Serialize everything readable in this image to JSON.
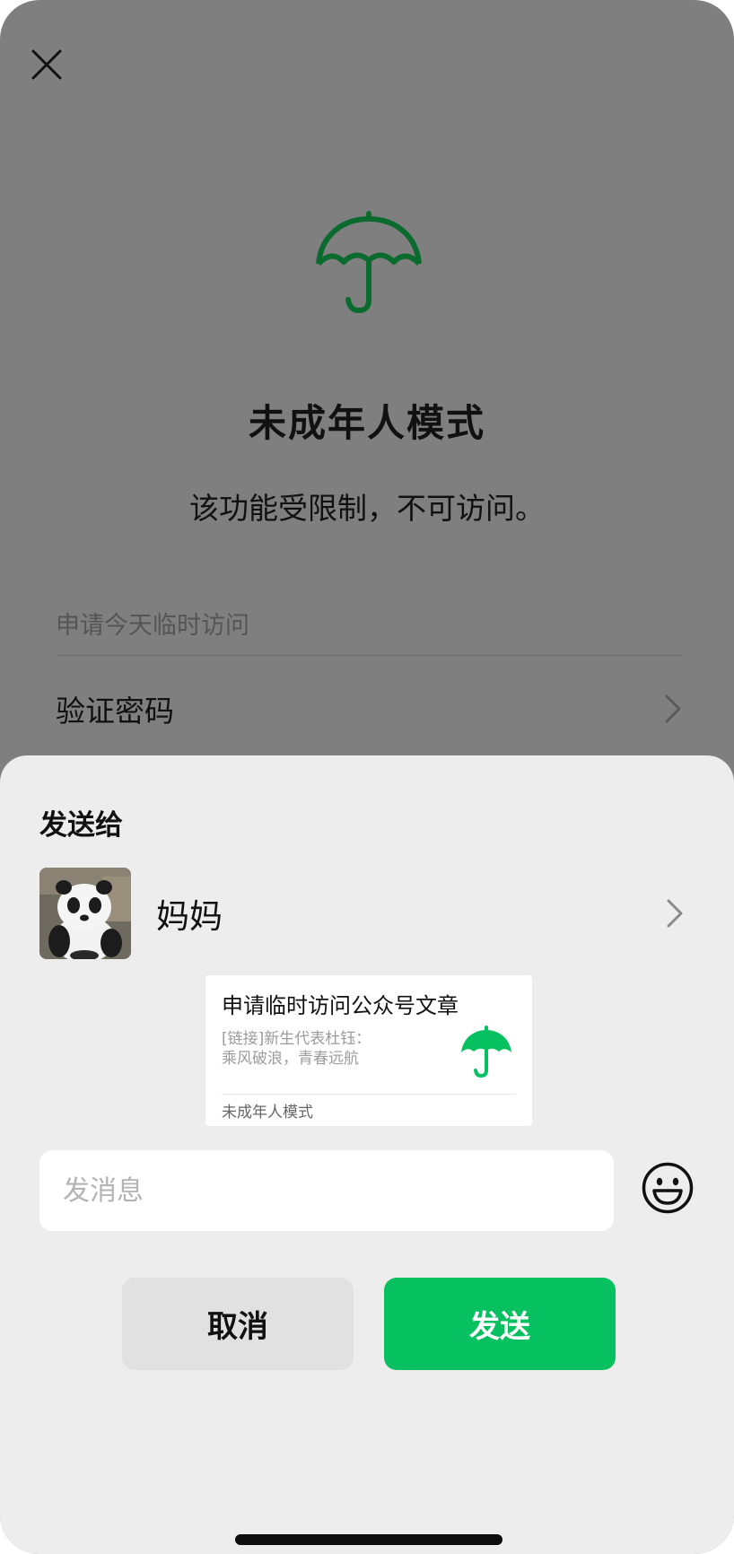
{
  "background": {
    "title": "未成年人模式",
    "description": "该功能受限制，不可访问。",
    "section_label": "申请今天临时访问",
    "verify_row_label": "验证密码"
  },
  "sheet": {
    "title": "发送给",
    "recipient": {
      "name": "妈妈"
    },
    "card": {
      "title": "申请临时访问公众号文章",
      "description_line1": "[链接]新生代表杜钰：",
      "description_line2": "乘风破浪，青春远航",
      "footer": "未成年人模式"
    },
    "message_input": {
      "placeholder": "发消息",
      "value": ""
    },
    "cancel_label": "取消",
    "send_label": "发送"
  },
  "colors": {
    "accent_green": "#07c160",
    "umbrella_dark_green": "#0b6b2f",
    "dim_overlay": "#7f7f7f",
    "sheet_background": "#ededed"
  },
  "icons": {
    "close": "close-icon",
    "umbrella": "umbrella-icon",
    "chevron": "chevron-right-icon",
    "emoji": "smiley-icon"
  }
}
